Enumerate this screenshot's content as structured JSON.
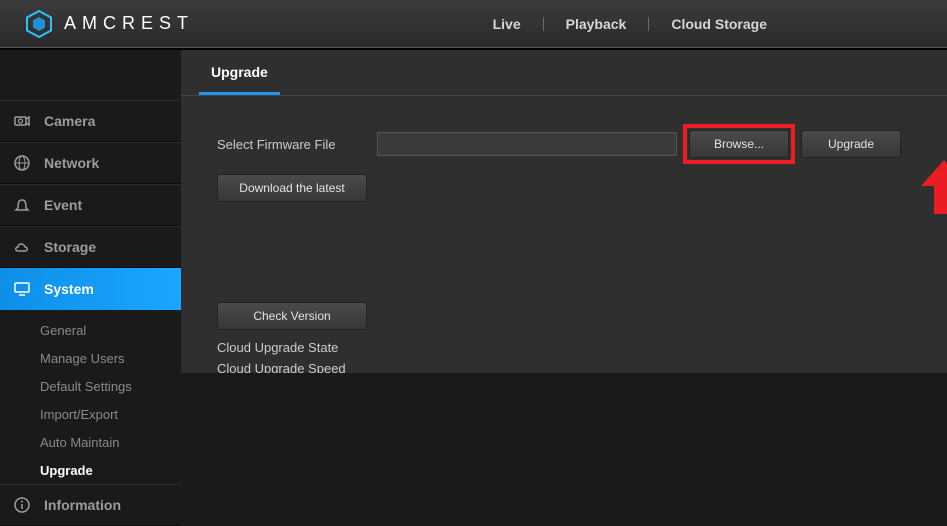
{
  "brand": {
    "name": "AMCREST"
  },
  "topnav": {
    "live": "Live",
    "playback": "Playback",
    "cloud": "Cloud Storage"
  },
  "sidebar": {
    "camera": "Camera",
    "network": "Network",
    "event": "Event",
    "storage": "Storage",
    "system": "System",
    "information": "Information",
    "system_sub": {
      "general": "General",
      "manage_users": "Manage Users",
      "default_settings": "Default Settings",
      "import_export": "Import/Export",
      "auto_maintain": "Auto Maintain",
      "upgrade": "Upgrade"
    }
  },
  "tab": {
    "upgrade": "Upgrade"
  },
  "form": {
    "select_firmware": "Select Firmware File",
    "download_latest": "Download the latest",
    "browse": "Browse...",
    "upgrade_btn": "Upgrade",
    "check_version": "Check Version",
    "cloud_state": "Cloud Upgrade State",
    "cloud_speed": "Cloud Upgrade Speed",
    "file_value": ""
  },
  "callout": {
    "color": "#ec1c24"
  }
}
